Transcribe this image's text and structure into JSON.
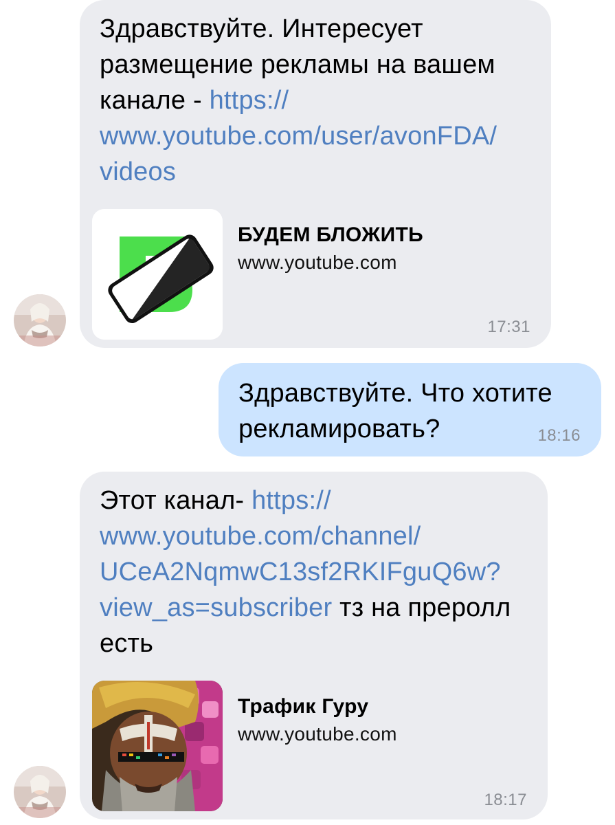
{
  "messages": [
    {
      "direction": "incoming",
      "text_before": "Здравствуйте. Интересует размещение рекламы на вашем канале - ",
      "link_line1": "https://",
      "link_line2": "www.youtube.com/user/avonFDA/",
      "link_line3": "videos",
      "preview_title": "БУДЕМ БЛОЖИТЬ",
      "preview_domain": "www.youtube.com",
      "time": "17:31"
    },
    {
      "direction": "outgoing",
      "text": "Здравствуйте. Что хотите рекламировать?",
      "time": "18:16"
    },
    {
      "direction": "incoming",
      "text_before": "Этот канал- ",
      "link_line1": "https://",
      "link_line2": "www.youtube.com/channel/",
      "link_line3": "UCeA2NqmwC13sf2RKIFguQ6w?",
      "link_line4": "view_as=subscriber",
      "text_after": " тз на преролл есть",
      "preview_title": "Трафик Гуру",
      "preview_domain": "www.youtube.com",
      "time": "18:17"
    }
  ],
  "colors": {
    "incoming_bubble": "#ebecf0",
    "outgoing_bubble": "#cce4ff",
    "link": "#4f7fc0",
    "time": "#8a8d93",
    "logo_green": "#4cde4c"
  },
  "icons": {
    "avatar": "user-photo-avatar",
    "thumb1": "budem-blozhit-logo",
    "thumb2": "trafik-guru-thumbnail"
  }
}
